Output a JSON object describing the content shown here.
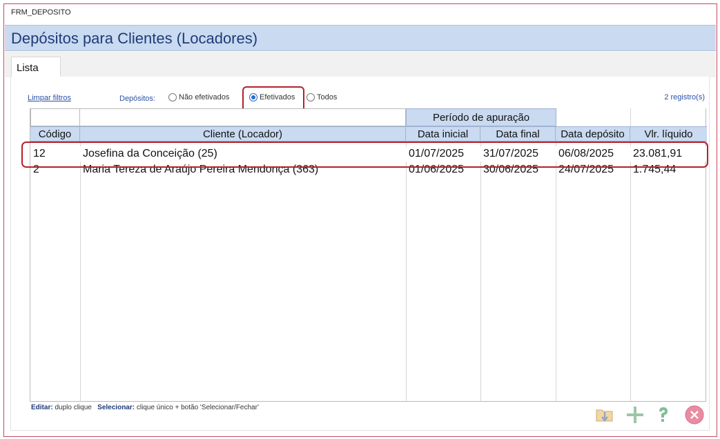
{
  "window": {
    "title": "FRM_DEPOSITO"
  },
  "header": {
    "title": "Depósitos para Clientes (Locadores)"
  },
  "tabs": [
    {
      "label": "Lista",
      "active": true
    }
  ],
  "filters": {
    "clear_link": "Limpar filtros",
    "label": "Depósitos:",
    "options": [
      {
        "label": "Não efetivados",
        "selected": false
      },
      {
        "label": "Efetivados",
        "selected": true
      },
      {
        "label": "Todos",
        "selected": false
      }
    ],
    "record_count": "2 registro(s)"
  },
  "grid": {
    "group_header": "Período de apuração",
    "columns": [
      "Código",
      "Cliente (Locador)",
      "Data inicial",
      "Data final",
      "Data depósito",
      "Vlr. líquido"
    ],
    "rows": [
      {
        "codigo": "12",
        "cliente": "Josefina da Conceição (25)",
        "data_inicial": "01/07/2025",
        "data_final": "31/07/2025",
        "data_deposito": "06/08/2025",
        "valor": "23.081,91"
      },
      {
        "codigo": "2",
        "cliente": "Maria Tereza de Araújo Pereira Mendonça (363)",
        "data_inicial": "01/06/2025",
        "data_final": "30/06/2025",
        "data_deposito": "24/07/2025",
        "valor": "1.745,44"
      }
    ]
  },
  "hint": {
    "editar_label": "Editar:",
    "editar_text": "duplo clique",
    "selecionar_label": "Selecionar:",
    "selecionar_text": "clique único + botão 'Selecionar/Fechar'"
  },
  "toolbar": {
    "buttons": [
      {
        "icon": "select-folder-icon"
      },
      {
        "icon": "add-icon"
      },
      {
        "icon": "help-icon"
      },
      {
        "icon": "close-icon"
      }
    ]
  },
  "colors": {
    "accent": "#c9daf1",
    "title": "#1f3b77",
    "highlight": "#b3202a",
    "close": "#e0607a"
  }
}
